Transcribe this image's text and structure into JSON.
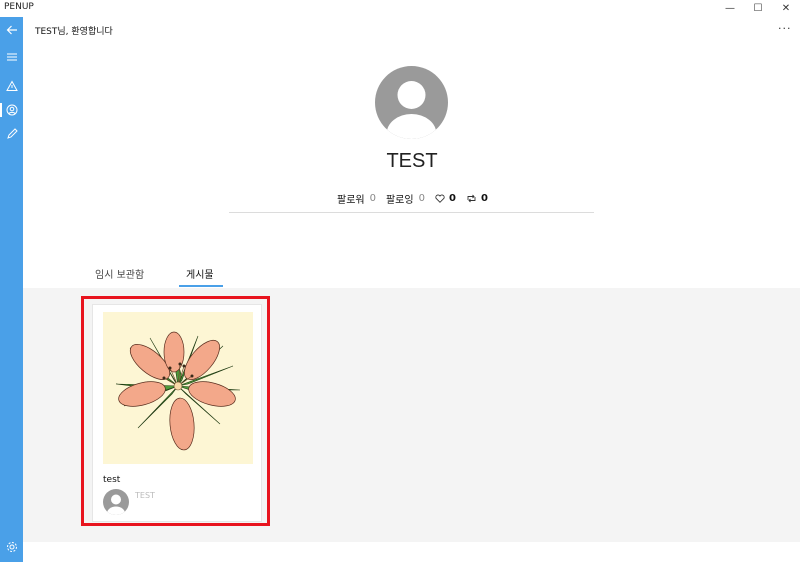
{
  "window": {
    "title": "PENUP",
    "minimize_glyph": "—",
    "maximize_glyph": "☐",
    "close_glyph": "✕"
  },
  "header": {
    "welcome_text": "TEST님, 환영합니다",
    "more_glyph": "···"
  },
  "sidebar": {
    "icons": [
      "back-arrow-icon",
      "menu-icon",
      "warning-icon",
      "profile-icon",
      "pencil-icon",
      "settings-icon"
    ],
    "accent_color": "#4aa0e8"
  },
  "profile": {
    "username": "TEST",
    "follower_label": "팔로워",
    "follower_count": "0",
    "following_label": "팔로잉",
    "following_count": "0",
    "likes_count": "0",
    "reposts_count": "0"
  },
  "tabs": [
    {
      "label": "임시 보관함",
      "active": false
    },
    {
      "label": "게시물",
      "active": true
    }
  ],
  "posts": [
    {
      "caption": "test",
      "author": "TEST",
      "artwork": "lily-flower-drawing"
    }
  ],
  "colors": {
    "highlight": "#e8141e",
    "card_art_bg": "#fdf6d4"
  }
}
